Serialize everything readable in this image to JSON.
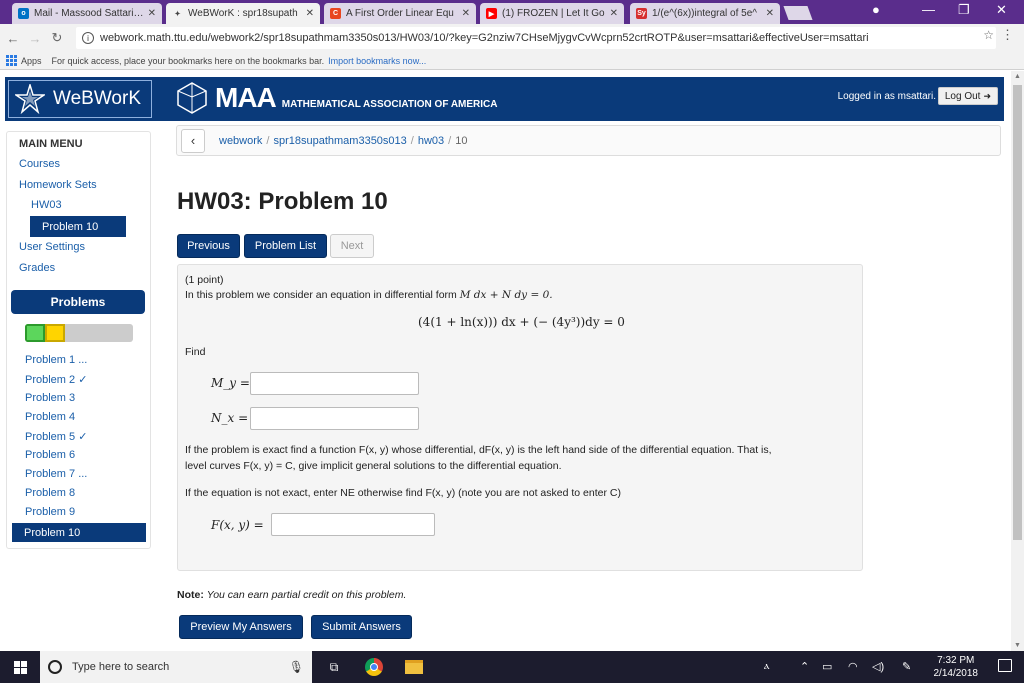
{
  "browser": {
    "tabs": [
      {
        "label": "Mail - Massood Sattari@",
        "favicon": "outlook-icon",
        "favicon_color": "#0072c6"
      },
      {
        "label": "WeBWorK : spr18supath",
        "favicon": "webwork-star-icon",
        "favicon_color": "#ffffff",
        "active": true
      },
      {
        "label": "A First Order Linear Equ",
        "favicon": "chegg-icon",
        "favicon_color": "#e8451e"
      },
      {
        "label": "(1) FROZEN | Let It Go",
        "favicon": "youtube-icon",
        "favicon_color": "#ff0000"
      },
      {
        "label": "1/(e^(6x))integral of 5e^",
        "favicon": "symbolab-icon",
        "favicon_color": "#d62f2f"
      }
    ],
    "url": "webwork.math.ttu.edu/webwork2/spr18supathmam3350s013/HW03/10/?key=G2nziw7CHseMjygvCvWcprn52crtROTP&user=msattari&effectiveUser=msattari",
    "bookmarks": {
      "apps_label": "Apps",
      "hint": "For quick access, place your bookmarks here on the bookmarks bar.",
      "import_link": "Import bookmarks now..."
    }
  },
  "header": {
    "logo_text": "WeBWorK",
    "maa_big": "MAA",
    "maa_small": "MATHEMATICAL ASSOCIATION OF AMERICA",
    "login_text": "Logged in as msattari.",
    "logout_label": "Log Out"
  },
  "sidebar": {
    "main_menu": "MAIN MENU",
    "courses": "Courses",
    "homework_sets": "Homework Sets",
    "hw03": "HW03",
    "problem_active": "Problem 10",
    "user_settings": "User Settings",
    "grades": "Grades",
    "problems_header": "Problems",
    "problems": [
      "Problem 1 ...",
      "Problem 2 ✓",
      "Problem 3",
      "Problem 4",
      "Problem 5 ✓",
      "Problem 6",
      "Problem 7 ...",
      "Problem 8",
      "Problem 9",
      "Problem 10"
    ]
  },
  "breadcrumb": {
    "items": [
      "webwork",
      "spr18supathmam3350s013",
      "hw03",
      "10"
    ]
  },
  "main": {
    "title": "HW03: Problem 10",
    "previous_label": "Previous",
    "problem_list_label": "Problem List",
    "next_label": "Next",
    "points": "(1 point)",
    "intro": "In this problem we consider an equation in differential form",
    "equation": "(4(1 + ln(x))) dx + (− (4y³))dy = 0",
    "find": "Find",
    "my_label": "M_y =",
    "nx_label": "N_x =",
    "exact_text_1": "If the problem is exact find a function F(x, y) whose differential, dF(x, y) is the left hand side of the differential equation. That is,",
    "exact_text_2": "level curves F(x, y) = C, give implicit general solutions to the differential equation.",
    "not_exact_text": "If the equation is not exact, enter NE otherwise find F(x, y) (note you are not asked to enter C)",
    "f_label": "F(x, y) =",
    "note_label": "Note:",
    "note_text": "You can earn partial credit on this problem.",
    "preview_label": "Preview My Answers",
    "submit_label": "Submit Answers"
  },
  "taskbar": {
    "search_placeholder": "Type here to search",
    "time": "7:32 PM",
    "date": "2/14/2018"
  },
  "colors": {
    "webwork_blue": "#0a3a7a",
    "link_blue": "#1b5fa9",
    "chrome_purple": "#5a2d8c"
  }
}
